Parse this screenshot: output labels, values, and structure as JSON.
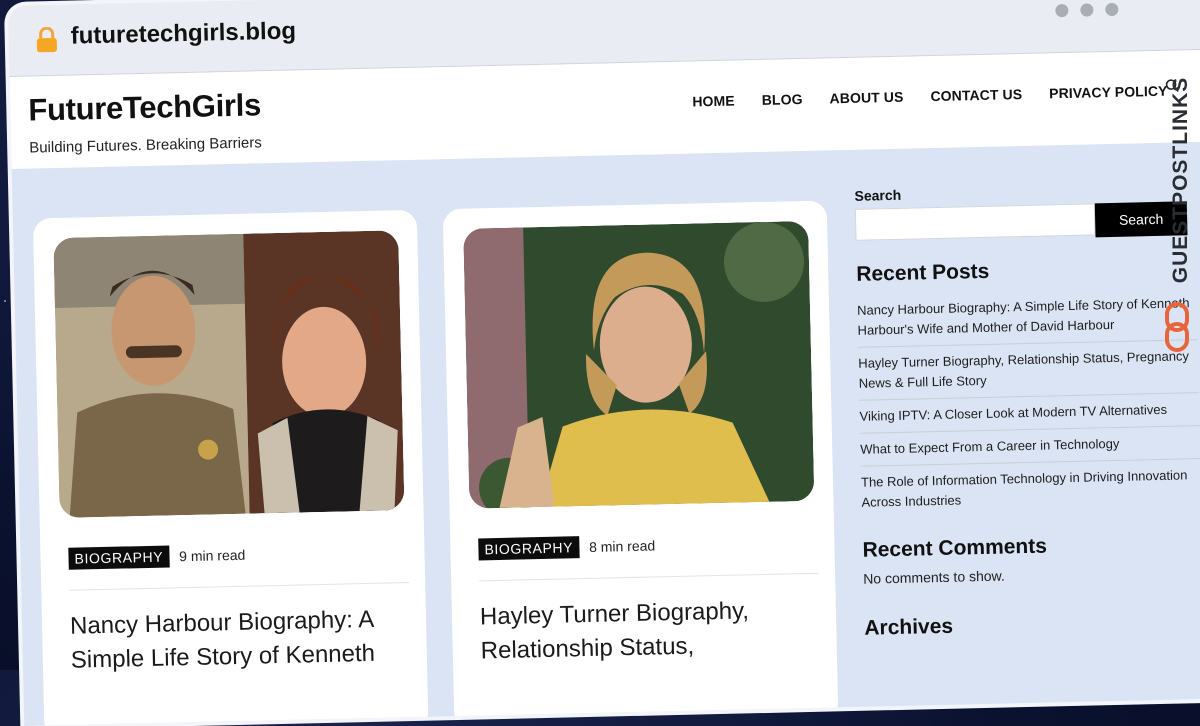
{
  "browser": {
    "url": "futuretechgirls.blog"
  },
  "site": {
    "title": "FutureTechGirls",
    "tagline": "Building Futures. Breaking Barriers"
  },
  "nav": {
    "items": [
      "HOME",
      "BLOG",
      "ABOUT US",
      "CONTACT US",
      "PRIVACY POLICY"
    ]
  },
  "posts": [
    {
      "category": "BIOGRAPHY",
      "read_time": "9 min read",
      "title": "Nancy Harbour Biography: A Simple Life Story of Kenneth"
    },
    {
      "category": "BIOGRAPHY",
      "read_time": "8 min read",
      "title": "Hayley Turner Biography, Relationship Status,"
    }
  ],
  "sidebar": {
    "search_label": "Search",
    "search_button": "Search",
    "recent_posts_heading": "Recent Posts",
    "recent_posts": [
      "Nancy Harbour Biography: A Simple Life Story of Kenneth Harbour's Wife and Mother of David Harbour",
      "Hayley Turner Biography, Relationship Status, Pregnancy News & Full Life Story",
      "Viking IPTV: A Closer Look at Modern TV Alternatives",
      "What to Expect From a Career in Technology",
      "The Role of Information Technology in Driving Innovation Across Industries"
    ],
    "recent_comments_heading": "Recent Comments",
    "no_comments": "No comments to show.",
    "archives_heading": "Archives"
  },
  "watermark": {
    "text": "GUESTPOSTLINKS"
  },
  "colors": {
    "page_bg": "#dbe4f4",
    "badge_bg": "#0c0c0c",
    "watermark_accent": "#e8643a"
  }
}
